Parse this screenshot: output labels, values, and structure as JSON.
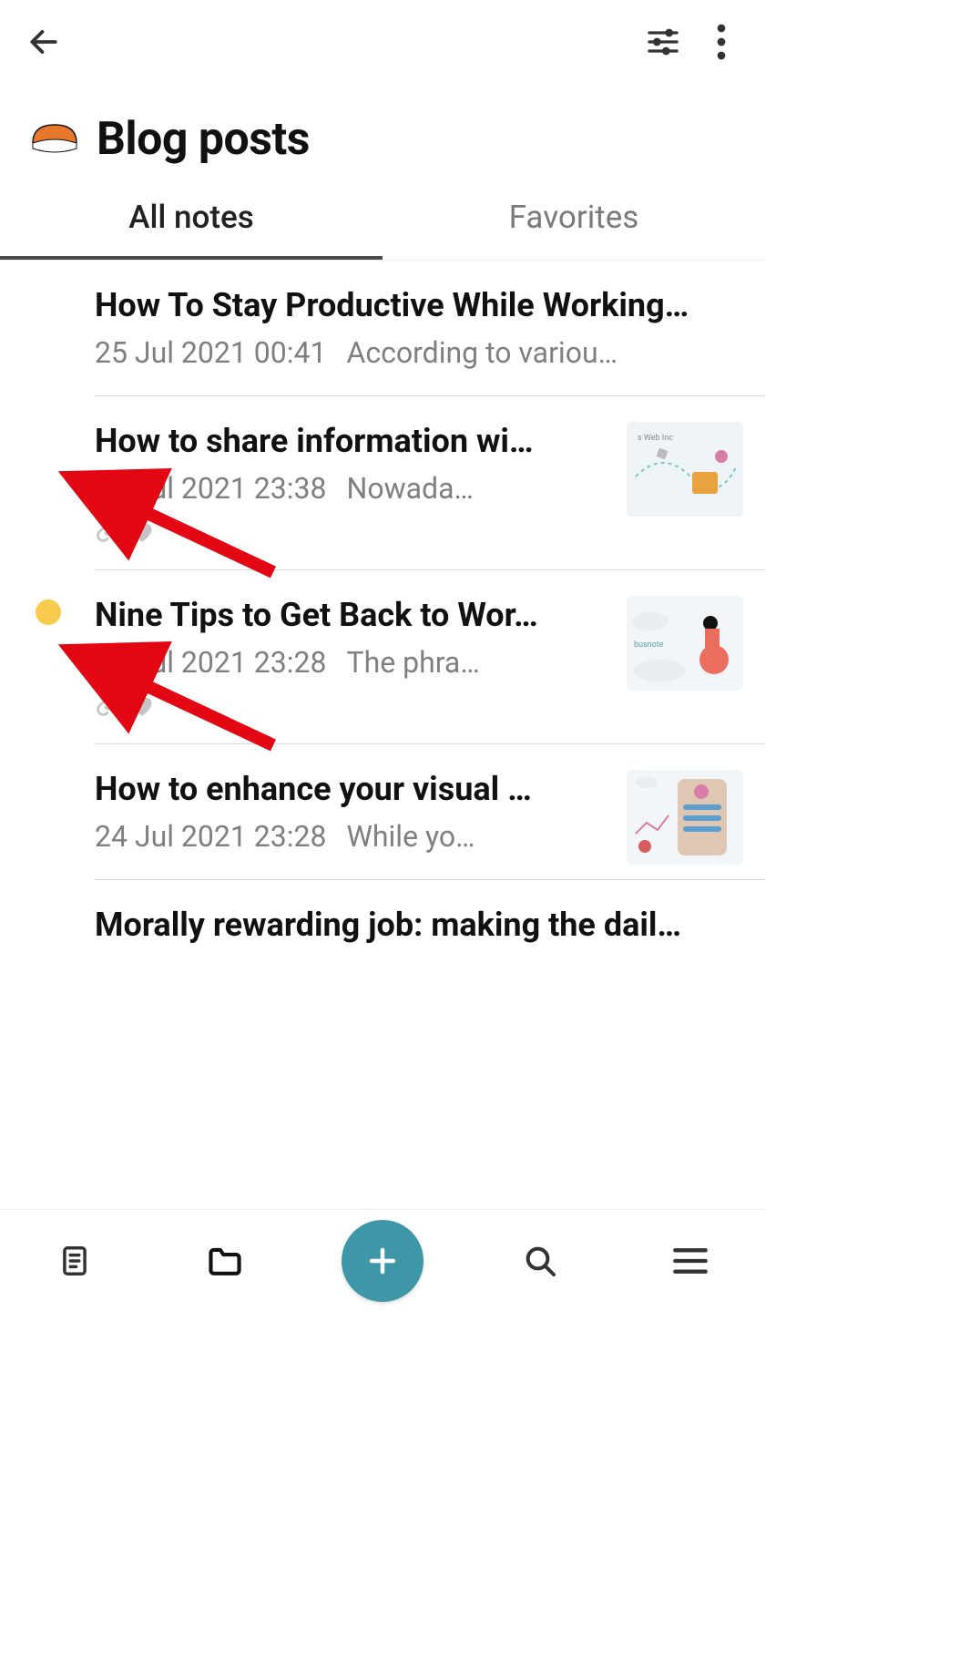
{
  "header": {
    "title": "Blog posts",
    "icon": "notebook"
  },
  "tabs": {
    "active": 0,
    "items": [
      {
        "label": "All notes"
      },
      {
        "label": "Favorites"
      }
    ]
  },
  "notes": [
    {
      "title": "How To Stay Productive While Working…",
      "date": "25 Jul 2021 00:41",
      "preview": "According to variou…",
      "marker": false,
      "has_link": false,
      "has_favorite": false,
      "has_thumb": false,
      "thumb": null
    },
    {
      "title": "How to share information wi…",
      "date": "24 Jul 2021 23:38",
      "preview": "Nowada…",
      "marker": false,
      "has_link": true,
      "has_favorite": true,
      "has_thumb": true,
      "thumb": "web-inc-abstract"
    },
    {
      "title": "Nine Tips to Get Back to Wor…",
      "date": "24 Jul 2021 23:28",
      "preview": "The phra…",
      "marker": true,
      "has_link": true,
      "has_favorite": true,
      "has_thumb": true,
      "thumb": "busnote-scooter"
    },
    {
      "title": "How to enhance your visual …",
      "date": "24 Jul 2021 23:28",
      "preview": "While yo…",
      "marker": false,
      "has_link": false,
      "has_favorite": false,
      "has_thumb": true,
      "thumb": "app-mockup"
    },
    {
      "title": "Morally rewarding job: making the dail…",
      "date": "",
      "preview": "",
      "marker": false,
      "has_link": false,
      "has_favorite": false,
      "has_thumb": false,
      "thumb": null
    }
  ],
  "annotations": {
    "arrows": [
      {
        "points_to": "note-2-link-icon"
      },
      {
        "points_to": "note-3-link-icon"
      }
    ]
  },
  "icons": {
    "back": "back-arrow-icon",
    "filter": "settings-sliders-icon",
    "overflow": "more-vertical-icon",
    "nav_notes": "note-icon",
    "nav_folders": "folder-icon",
    "nav_add": "add-icon",
    "nav_search": "search-icon",
    "nav_menu": "menu-icon"
  }
}
